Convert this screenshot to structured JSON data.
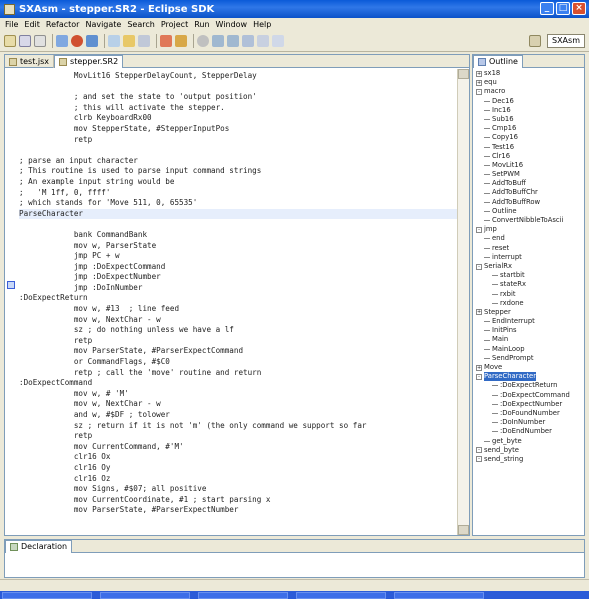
{
  "window": {
    "title": "SXAsm - stepper.SR2 - Eclipse SDK"
  },
  "menu": [
    "File",
    "Edit",
    "Refactor",
    "Navigate",
    "Search",
    "Project",
    "Run",
    "Window",
    "Help"
  ],
  "perspective": {
    "label": "SXAsm"
  },
  "editor": {
    "tabs": [
      {
        "label": "test.jsx",
        "active": false
      },
      {
        "label": "stepper.SR2",
        "active": true
      }
    ],
    "lines": [
      "            MovLit16 StepperDelayCount, StepperDelay",
      "",
      "            ; and set the state to 'output position'",
      "            ; this will activate the stepper.",
      "            clrb KeyboardRx00",
      "            mov StepperState, #StepperInputPos",
      "            retp",
      "",
      "; parse an input character",
      "; This routine is used to parse input command strings",
      "; An example input string would be",
      ";   'M 1ff, 0, ffff'",
      "; which stands for 'Move 511, 0, 65535'",
      "ParseCharacter",
      "",
      "            bank CommandBank",
      "            mov w, ParserState",
      "            jmp PC + w",
      "            jmp :DoExpectCommand",
      "            jmp :DoExpectNumber",
      "            jmp :DoInNumber",
      ":DoExpectReturn",
      "            mov w, #13  ; line feed",
      "            mov w, NextChar - w",
      "            sz ; do nothing unless we have a lf",
      "            retp",
      "            mov ParserState, #ParserExpectCommand",
      "            or CommandFlags, #$C0",
      "            retp ; call the 'move' routine and return",
      ":DoExpectCommand",
      "            mov w, # 'M'",
      "            mov w, NextChar - w",
      "            and w, #$DF ; tolower",
      "            sz ; return if it is not 'm' (the only command we support so far",
      "            retp",
      "            mov CurrentCommand, #'M'",
      "            clr16 Ox",
      "            clr16 Oy",
      "            clr16 Oz",
      "            mov Signs, #$07; all positive",
      "            mov CurrentCoordinate, #1 ; start parsing x",
      "            mov ParserState, #ParserExpectNumber"
    ]
  },
  "outline": {
    "tab": "Outline",
    "items": [
      {
        "label": "sx18",
        "depth": 0,
        "exp": "+"
      },
      {
        "label": "equ",
        "depth": 0,
        "exp": "+"
      },
      {
        "label": "macro",
        "depth": 0,
        "exp": "-"
      },
      {
        "label": "Dec16",
        "depth": 1
      },
      {
        "label": "Inc16",
        "depth": 1
      },
      {
        "label": "Sub16",
        "depth": 1
      },
      {
        "label": "Cmp16",
        "depth": 1
      },
      {
        "label": "Copy16",
        "depth": 1
      },
      {
        "label": "Test16",
        "depth": 1
      },
      {
        "label": "Clr16",
        "depth": 1
      },
      {
        "label": "MovLit16",
        "depth": 1
      },
      {
        "label": "SetPWM",
        "depth": 1
      },
      {
        "label": "AddToBuff",
        "depth": 1
      },
      {
        "label": "AddToBuffChr",
        "depth": 1
      },
      {
        "label": "AddToBuffRow",
        "depth": 1
      },
      {
        "label": "Outline",
        "depth": 1
      },
      {
        "label": "ConvertNibbleToAscii",
        "depth": 1
      },
      {
        "label": "jmp",
        "depth": 0,
        "exp": "-"
      },
      {
        "label": "end",
        "depth": 1
      },
      {
        "label": "reset",
        "depth": 1
      },
      {
        "label": "interrupt",
        "depth": 1
      },
      {
        "label": "SerialRx",
        "depth": 0,
        "exp": "-"
      },
      {
        "label": "startbit",
        "depth": 2
      },
      {
        "label": "stateRx",
        "depth": 2
      },
      {
        "label": "rxbit",
        "depth": 2
      },
      {
        "label": "rxdone",
        "depth": 2
      },
      {
        "label": "Stepper",
        "depth": 0,
        "exp": "+"
      },
      {
        "label": "EndInterrupt",
        "depth": 1
      },
      {
        "label": "InitPins",
        "depth": 1
      },
      {
        "label": "Main",
        "depth": 1
      },
      {
        "label": "MainLoop",
        "depth": 1
      },
      {
        "label": "SendPrompt",
        "depth": 1
      },
      {
        "label": "Move",
        "depth": 0,
        "exp": "+"
      },
      {
        "label": "ParseCharacter",
        "depth": 0,
        "exp": "-",
        "selected": true
      },
      {
        "label": ":DoExpectReturn",
        "depth": 2
      },
      {
        "label": ":DoExpectCommand",
        "depth": 2
      },
      {
        "label": ":DoExpectNumber",
        "depth": 2
      },
      {
        "label": ":DoFoundNumber",
        "depth": 2
      },
      {
        "label": ":DoInNumber",
        "depth": 2
      },
      {
        "label": ":DoEndNumber",
        "depth": 2
      },
      {
        "label": "get_byte",
        "depth": 1
      },
      {
        "label": "send_byte",
        "depth": 0,
        "exp": "-"
      },
      {
        "label": "send_string",
        "depth": 0,
        "exp": "-"
      }
    ]
  },
  "declaration": {
    "tab": "Declaration"
  },
  "colors": {
    "titlebar": "#0a5ad8",
    "selection": "#316ac5"
  }
}
